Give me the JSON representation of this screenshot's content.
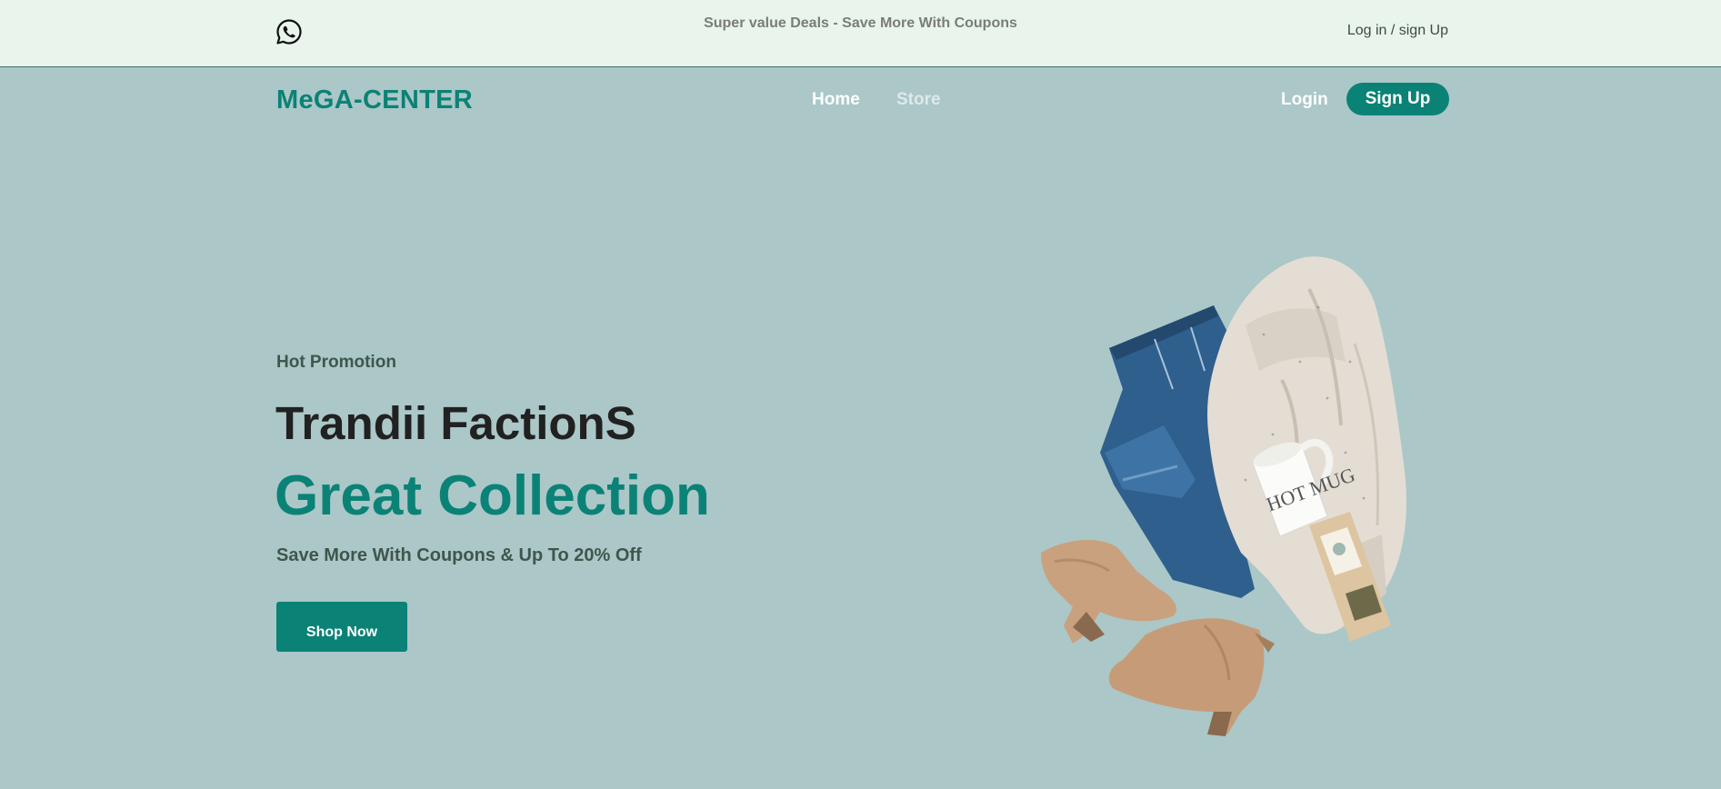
{
  "topbar": {
    "contact_icon": "whatsapp-icon",
    "deals_text": "Super value Deals - Save More With Coupons",
    "auth_link": "Log in / sign Up"
  },
  "nav": {
    "logo": "MeGA-CENTER",
    "links": [
      {
        "label": "Home"
      },
      {
        "label": "Store"
      }
    ],
    "login_label": "Login",
    "signup_label": "Sign Up"
  },
  "hero": {
    "eyebrow": "Hot Promotion",
    "title": "Trandii FactionS",
    "subtitle": "Great Collection",
    "description": "Save More With Coupons & Up To 20% Off",
    "cta_label": "Shop Now",
    "image": "flat-lay-outfit-image"
  },
  "colors": {
    "accent": "#0b8276",
    "background": "#abc7c8",
    "topbar_background": "#e9f5ec",
    "dark_text": "#212121",
    "muted_text": "#3f564c"
  }
}
